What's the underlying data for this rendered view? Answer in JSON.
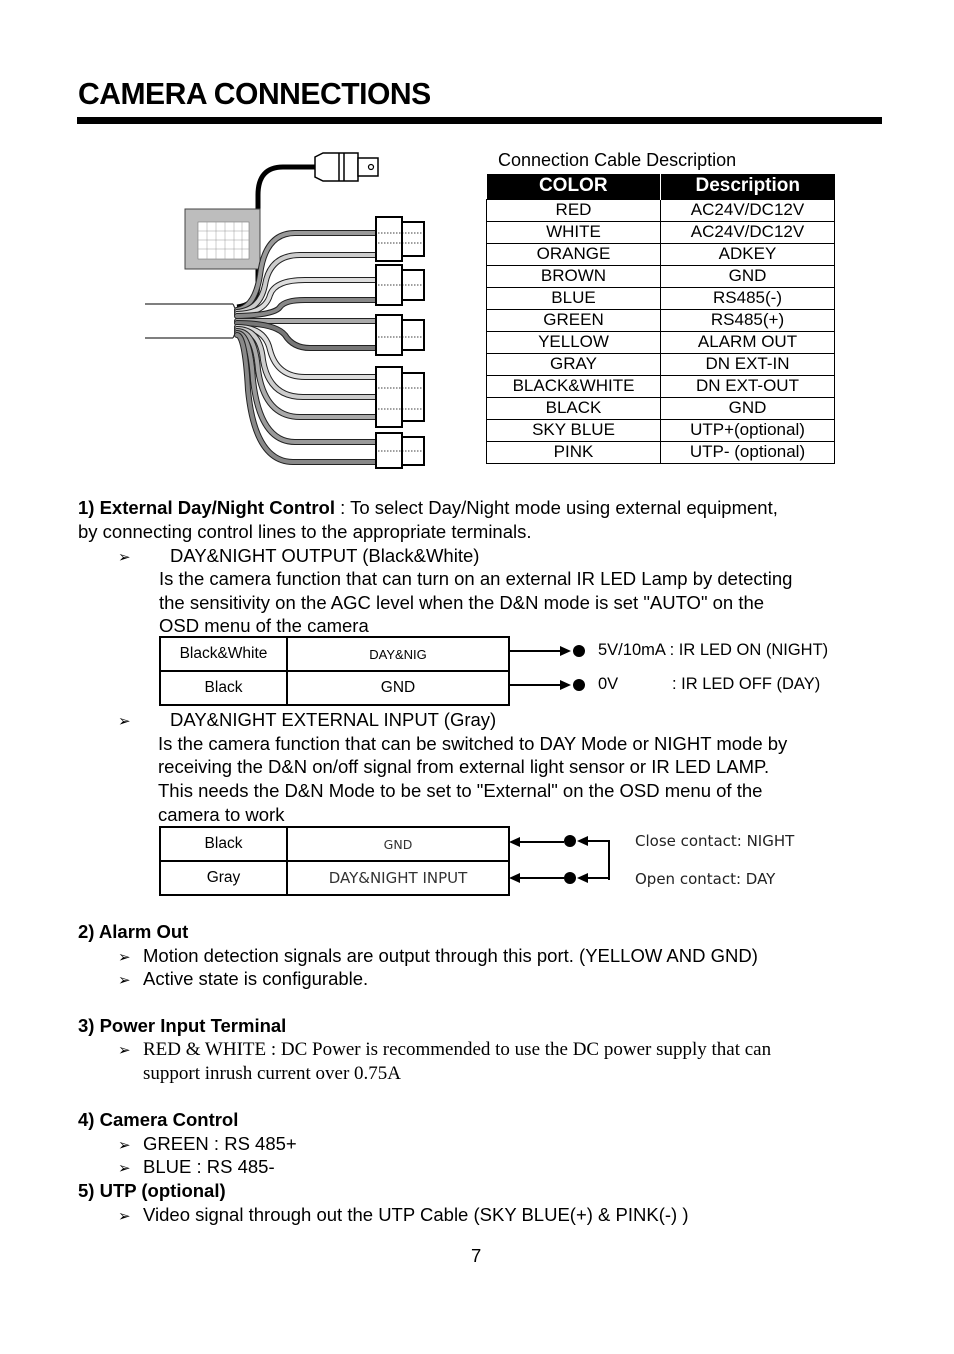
{
  "page": {
    "title": "CAMERA CONNECTIONS",
    "page_number": "7"
  },
  "cable_table": {
    "caption": "Connection Cable Description",
    "headers": [
      "COLOR",
      "Description"
    ],
    "rows": [
      {
        "color": "RED",
        "description": "AC24V/DC12V"
      },
      {
        "color": "WHITE",
        "description": "AC24V/DC12V"
      },
      {
        "color": "ORANGE",
        "description": "ADKEY"
      },
      {
        "color": "BROWN",
        "description": "GND"
      },
      {
        "color": "BLUE",
        "description": "RS485(-)"
      },
      {
        "color": "GREEN",
        "description": "RS485(+)"
      },
      {
        "color": "YELLOW",
        "description": "ALARM OUT"
      },
      {
        "color": "GRAY",
        "description": "DN EXT-IN"
      },
      {
        "color": "BLACK&WHITE",
        "description": "DN EXT-OUT"
      },
      {
        "color": "BLACK",
        "description": "GND"
      },
      {
        "color": "SKY BLUE",
        "description": "UTP+(optional)"
      },
      {
        "color": "PINK",
        "description": "UTP- (optional)"
      }
    ]
  },
  "section1": {
    "heading": "1) External Day/Night Control",
    "intro_line1": " : To select Day/Night mode using external equipment,",
    "intro_line2": "by connecting control lines to the appropriate terminals.",
    "output": {
      "title": "DAY&NIGHT OUTPUT (Black&White)",
      "lines": [
        "Is the camera function that can turn on an external IR LED Lamp by detecting",
        "the sensitivity on the AGC level when the D&N mode is set \"AUTO\" on the",
        "OSD menu of the camera"
      ],
      "wires": [
        {
          "wire": "Black&White",
          "signal": "DAY&NIG",
          "value": "5V/10mA",
          "result": ": IR LED ON (NIGHT)"
        },
        {
          "wire": "Black",
          "signal": "GND",
          "value": "0V",
          "result": ": IR LED OFF (DAY)"
        }
      ]
    },
    "input": {
      "title": "DAY&NIGHT EXTERNAL INPUT (Gray)",
      "lines": [
        "Is the camera function that can be switched to DAY Mode or NIGHT mode by",
        "receiving the D&N on/off signal from external light sensor or IR LED LAMP.",
        "This needs the D&N Mode to be set to \"External\" on the OSD menu of the",
        "camera to work"
      ],
      "wires": [
        {
          "wire": "Black",
          "signal": "GND"
        },
        {
          "wire": "Gray",
          "signal": "DAY&NIGHT INPUT"
        }
      ],
      "notes": [
        "Close contact: NIGHT",
        "Open contact: DAY"
      ]
    }
  },
  "section2": {
    "heading": "2) Alarm Out",
    "bullets": [
      "Motion detection signals are output through this port.  (YELLOW AND GND)",
      "Active state is configurable."
    ]
  },
  "section3": {
    "heading": "3) Power Input Terminal",
    "bullet_line1": "RED & WHITE : DC Power is recommended to use the DC power supply that can",
    "bullet_line2": "support inrush current over 0.75A"
  },
  "section4": {
    "heading": "4) Camera Control",
    "bullets": [
      "GREEN : RS 485+",
      "BLUE : RS 485-"
    ]
  },
  "section5": {
    "heading": "5) UTP (optional)",
    "bullets": [
      "Video signal through out the UTP Cable (SKY BLUE(+) & PINK(-) )"
    ]
  },
  "icons": {
    "bullet": "➢"
  }
}
